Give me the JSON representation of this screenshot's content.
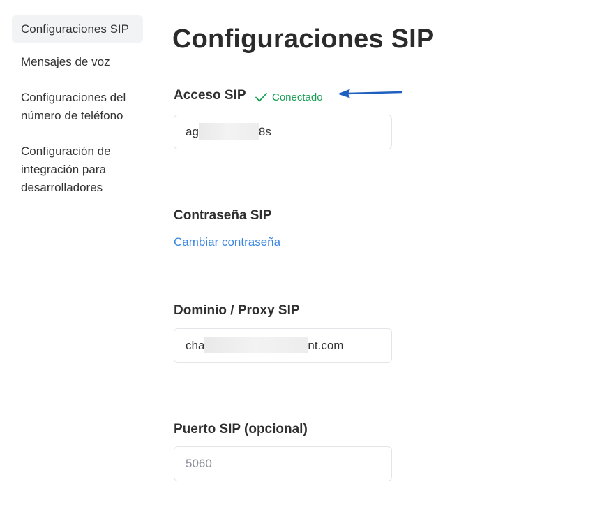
{
  "sidebar": {
    "items": [
      {
        "label": "Configuraciones SIP",
        "active": true
      },
      {
        "label": "Mensajes de voz"
      },
      {
        "label_lines": [
          "Configuraciones del",
          "número de teléfono"
        ]
      },
      {
        "label_lines": [
          "Configuración de",
          "integración para",
          "desarrolladores"
        ]
      }
    ]
  },
  "main": {
    "title": "Configuraciones SIP",
    "sip_access": {
      "label": "Acceso SIP",
      "status": "Conectado",
      "status_color": "#1aa053",
      "value_prefix": "ag",
      "value_suffix": "8s"
    },
    "sip_password": {
      "label": "Contraseña SIP",
      "link": "Cambiar contraseña",
      "link_color": "#3a86e0"
    },
    "sip_domain": {
      "label": "Dominio / Proxy SIP",
      "value_prefix": "cha",
      "value_suffix": "nt.com"
    },
    "sip_port": {
      "label": "Puerto SIP (opcional)",
      "placeholder": "5060"
    }
  },
  "icons": {
    "check": "check-icon",
    "annotation_arrow": "arrow-left-icon"
  }
}
